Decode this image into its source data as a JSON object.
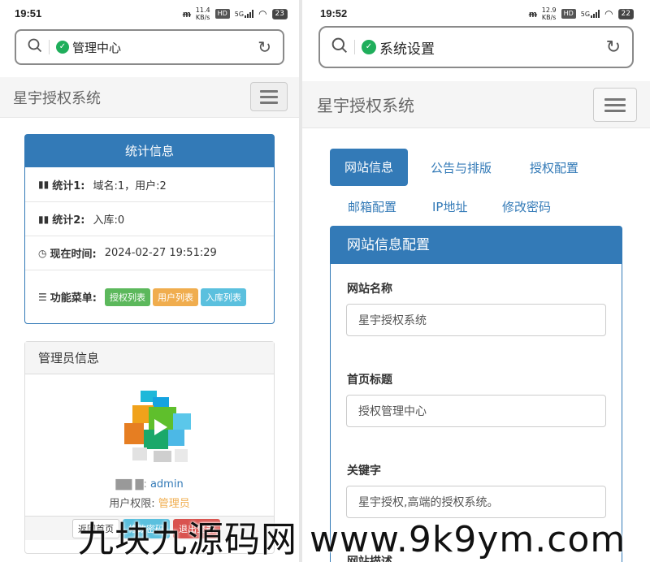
{
  "left": {
    "status": {
      "time": "19:51",
      "speed": "11.4",
      "speed_unit": "KB/s",
      "hd": "HD",
      "net": "5G",
      "battery": "23"
    },
    "address": {
      "title": "管理中心"
    },
    "brand": "星宇授权系统",
    "stats_card": {
      "title": "统计信息",
      "rows": [
        {
          "label": "统计1:",
          "value": "域名:1，用户:2"
        },
        {
          "label": "统计2:",
          "value": "入库:0"
        },
        {
          "label": "现在时间:",
          "value": "2024-02-27 19:51:29"
        }
      ],
      "menu_label": "功能菜单:",
      "menu_items": [
        "授权列表",
        "用户列表",
        "入库列表"
      ]
    },
    "admin_card": {
      "title": "管理员信息",
      "username": "admin",
      "permission_label": "用户权限:",
      "permission_value": "管理员",
      "buttons": [
        "返回首页",
        "修改密码",
        "退出登录"
      ]
    }
  },
  "right": {
    "status": {
      "time": "19:52",
      "speed": "12.9",
      "speed_unit": "KB/s",
      "hd": "HD",
      "net": "5G",
      "battery": "22"
    },
    "address": {
      "title": "系统设置"
    },
    "brand": "星宇授权系统",
    "tabs": [
      "网站信息",
      "公告与排版",
      "授权配置",
      "邮箱配置",
      "IP地址",
      "修改密码"
    ],
    "panel": {
      "title": "网站信息配置",
      "fields": [
        {
          "label": "网站名称",
          "value": "星宇授权系统"
        },
        {
          "label": "首页标题",
          "value": "授权管理中心"
        },
        {
          "label": "关键字",
          "value": "星宇授权,高端的授权系统。"
        },
        {
          "label": "网站描述"
        }
      ]
    }
  },
  "watermark": "九块九源码网 www.9k9ym.com",
  "colors": {
    "primary": "#337ab7",
    "success": "#5cb85c",
    "warning": "#f0ad4e",
    "info": "#5bc0de",
    "danger": "#d9534f",
    "shield": "#1fae5b"
  }
}
